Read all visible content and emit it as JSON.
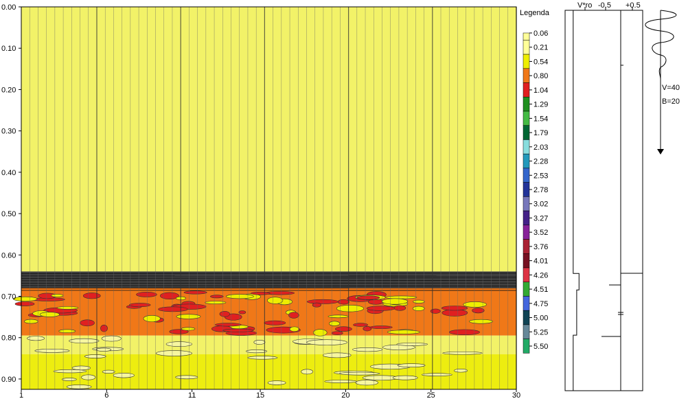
{
  "chart_data": [
    {
      "type": "heatmap",
      "title": "",
      "xlabel": "",
      "ylabel": "",
      "x_ticks": [
        1,
        6,
        11,
        15,
        20,
        25,
        30
      ],
      "xlim": [
        1,
        30
      ],
      "y_ticks": [
        "0.00",
        "0.10",
        "0.20",
        "0.30",
        "0.40",
        "0.50",
        "0.60",
        "0.70",
        "0.80",
        "0.90"
      ],
      "ylim": [
        0.0,
        0.925
      ],
      "legend_title": "Legenda",
      "legend_placement": "right",
      "legend": [
        {
          "label": "0.06",
          "color": "#FFFF99"
        },
        {
          "label": "0.21",
          "color": "#FFFF99"
        },
        {
          "label": "0.54",
          "color": "#EEEE00"
        },
        {
          "label": "0.80",
          "color": "#F07818"
        },
        {
          "label": "1.04",
          "color": "#E02020"
        },
        {
          "label": "1.29",
          "color": "#209020"
        },
        {
          "label": "1.54",
          "color": "#44BB44"
        },
        {
          "label": "1.79",
          "color": "#006633"
        },
        {
          "label": "2.03",
          "color": "#88DDDD"
        },
        {
          "label": "2.28",
          "color": "#2299BB"
        },
        {
          "label": "2.53",
          "color": "#3366CC"
        },
        {
          "label": "2.78",
          "color": "#223399"
        },
        {
          "label": "3.02",
          "color": "#7777BB"
        },
        {
          "label": "3.27",
          "color": "#442288"
        },
        {
          "label": "3.52",
          "color": "#882299"
        },
        {
          "label": "3.76",
          "color": "#AA2233"
        },
        {
          "label": "4.01",
          "color": "#771122"
        },
        {
          "label": "4.26",
          "color": "#DD3344"
        },
        {
          "label": "4.51",
          "color": "#33AA33"
        },
        {
          "label": "4.75",
          "color": "#4466DD"
        },
        {
          "label": "5.00",
          "color": "#114455"
        },
        {
          "label": "5.25",
          "color": "#668899"
        },
        {
          "label": "5.50",
          "color": "#22AA66"
        }
      ],
      "bands": [
        {
          "from": 0.0,
          "to": 0.64,
          "color": "#F2F268"
        },
        {
          "from": 0.64,
          "to": 0.68,
          "color": "#404040"
        },
        {
          "from": 0.68,
          "to": 0.795,
          "color": "#F07818"
        },
        {
          "from": 0.795,
          "to": 0.84,
          "color": "#F2F268"
        },
        {
          "from": 0.84,
          "to": 0.925,
          "color": "#EDED10"
        }
      ]
    },
    {
      "type": "line",
      "title": "",
      "series": [
        {
          "name": "V*ro",
          "depths": [
            0.0,
            0.64,
            0.64,
            0.68,
            0.68,
            0.79,
            0.79,
            0.925
          ],
          "values": [
            0.2,
            0.2,
            0.45,
            0.45,
            0.35,
            0.35,
            0.2,
            0.2
          ]
        }
      ],
      "header_labels": [
        "V*ro",
        "-0.5",
        "+0.5"
      ],
      "annotations": [
        "V=40",
        "B=20"
      ]
    }
  ]
}
